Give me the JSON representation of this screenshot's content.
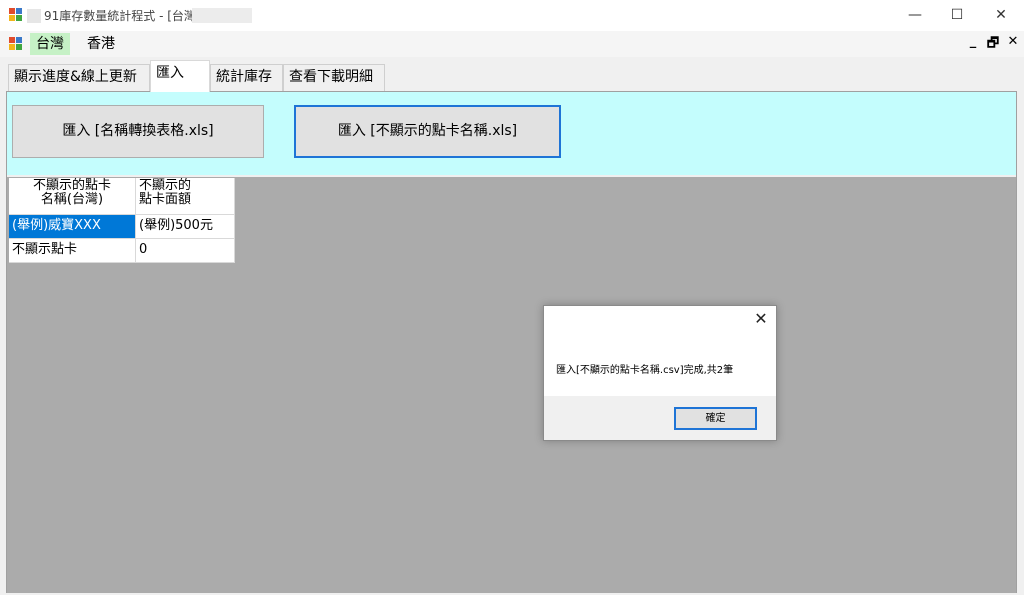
{
  "window": {
    "title": "91庫存數量統計程式 - [台灣",
    "minimize_glyph": "—",
    "maximize_glyph": "☐",
    "close_glyph": "✕",
    "icon": "app-window-icon"
  },
  "menubar": {
    "items": [
      {
        "label": "台灣"
      },
      {
        "label": "香港"
      }
    ],
    "mdi_minimize": "_",
    "mdi_restore": "🗗",
    "mdi_close": "✕"
  },
  "tabs": [
    {
      "label": "顯示進度&線上更新"
    },
    {
      "label": "匯入"
    },
    {
      "label": "統計庫存"
    },
    {
      "label": "查看下載明細"
    }
  ],
  "import_buttons": {
    "name_table": "匯入 [名稱轉換表格.xls]",
    "hidden_cards": "匯入 [不顯示的點卡名稱.xls]"
  },
  "grid": {
    "headers": [
      "不顯示的點卡\n名稱(台灣)",
      "不顯示的\n點卡面額"
    ],
    "rows": [
      [
        "(舉例)威寶XXX",
        "(舉例)500元"
      ],
      [
        "不顯示點卡",
        "0"
      ]
    ]
  },
  "dialog": {
    "close_glyph": "✕",
    "message": "匯入[不顯示的點卡名稱.csv]完成,共2筆",
    "ok_label": "確定"
  },
  "colors": {
    "accent": "#1e74d6",
    "selection": "#0078d7",
    "band": "#c4fdfd",
    "active_menu": "#c6f1c6",
    "grid_background": "#ababab"
  }
}
